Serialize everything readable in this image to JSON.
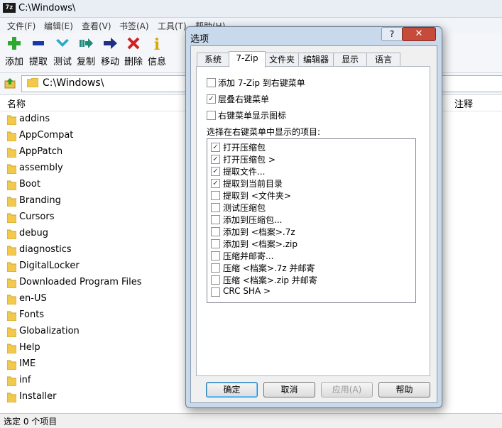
{
  "window": {
    "title": "C:\\Windows\\",
    "app_icon_text": "7z"
  },
  "menu": [
    "文件(F)",
    "编辑(E)",
    "查看(V)",
    "书签(A)",
    "工具(T)",
    "帮助(H)"
  ],
  "toolbar": [
    {
      "label": "添加",
      "icon": "add-icon",
      "color": "#2fa82f"
    },
    {
      "label": "提取",
      "icon": "extract-icon",
      "color": "#1638a8"
    },
    {
      "label": "测试",
      "icon": "test-icon",
      "color": "#2aa7c8"
    },
    {
      "label": "复制",
      "icon": "copy-icon",
      "color": "#1f8a7a"
    },
    {
      "label": "移动",
      "icon": "move-icon",
      "color": "#1e2f8a"
    },
    {
      "label": "删除",
      "icon": "delete-icon",
      "color": "#d22020"
    },
    {
      "label": "信息",
      "icon": "info-icon",
      "color": "#d8a800"
    }
  ],
  "address": {
    "path": "C:\\Windows\\"
  },
  "columns": {
    "name": "名称",
    "comment": "注释"
  },
  "files": [
    "addins",
    "AppCompat",
    "AppPatch",
    "assembly",
    "Boot",
    "Branding",
    "Cursors",
    "debug",
    "diagnostics",
    "DigitalLocker",
    "Downloaded Program Files",
    "en-US",
    "Fonts",
    "Globalization",
    "Help",
    "IME",
    "inf",
    "Installer"
  ],
  "status": {
    "text": "选定 0 个项目"
  },
  "dialog": {
    "title": "选项",
    "help_glyph": "?",
    "close_glyph": "✕",
    "tabs": [
      "系统",
      "7-Zip",
      "文件夹",
      "编辑器",
      "显示",
      "语言"
    ],
    "options": [
      {
        "label": "添加 7-Zip 到右键菜单",
        "checked": false
      },
      {
        "label": "层叠右键菜单",
        "checked": true
      },
      {
        "label": "右键菜单显示图标",
        "checked": false
      }
    ],
    "list_caption": "选择在右键菜单中显示的项目:",
    "items": [
      {
        "label": "打开压缩包",
        "checked": true
      },
      {
        "label": "打开压缩包 >",
        "checked": true
      },
      {
        "label": "提取文件...",
        "checked": true
      },
      {
        "label": "提取到当前目录",
        "checked": true
      },
      {
        "label": "提取到 <文件夹>",
        "checked": false
      },
      {
        "label": "测试压缩包",
        "checked": false
      },
      {
        "label": "添加到压缩包...",
        "checked": false
      },
      {
        "label": "添加到 <档案>.7z",
        "checked": false
      },
      {
        "label": "添加到 <档案>.zip",
        "checked": false
      },
      {
        "label": "压缩并邮寄...",
        "checked": false
      },
      {
        "label": "压缩 <档案>.7z 并邮寄",
        "checked": false
      },
      {
        "label": "压缩 <档案>.zip 并邮寄",
        "checked": false
      },
      {
        "label": "CRC SHA >",
        "checked": false
      }
    ],
    "buttons": {
      "ok": "确定",
      "cancel": "取消",
      "apply": "应用(A)",
      "help": "帮助"
    }
  }
}
